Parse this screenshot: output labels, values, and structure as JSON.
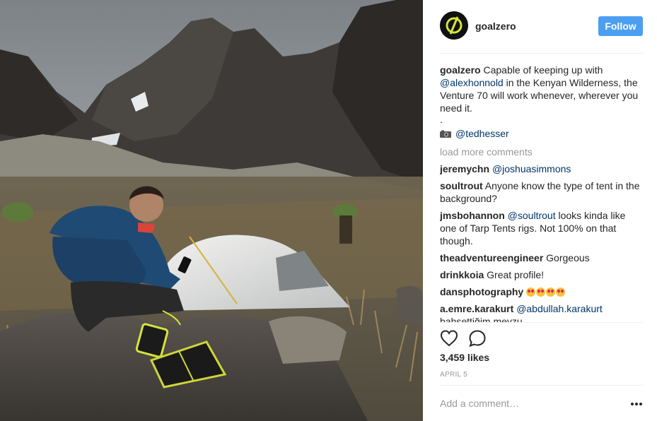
{
  "post": {
    "username": "goalzero",
    "follow_label": "Follow",
    "caption": {
      "username": "goalzero",
      "text_before": "Capable of keeping up with ",
      "mention": "@alexhonnold",
      "text_after": " in the Kenyan Wilderness, the Venture 70 will work whenever, wherever you need it.",
      "dot": ".",
      "credit_icon": "camera-emoji-icon",
      "credit": "@tedhesser"
    },
    "load_more": "load more comments",
    "comments": [
      {
        "user": "jeremychn",
        "mention": "@joshuasimmons",
        "text": ""
      },
      {
        "user": "soultrout",
        "mention": "",
        "text": "Anyone know the type of tent in the background?"
      },
      {
        "user": "jmsbohannon",
        "mention": "@soultrout",
        "text": " looks kinda like one of Tarp Tents rigs. Not 100% on that though."
      },
      {
        "user": "theadventureengineer",
        "mention": "",
        "text": "Gorgeous"
      },
      {
        "user": "drinkkoia",
        "mention": "",
        "text": "Great profile!"
      },
      {
        "user": "dansphotography",
        "mention": "",
        "text": "",
        "emoji": "heart-eyes-emoji x4"
      },
      {
        "user": "a.emre.karakurt",
        "mention": "@abdullah.karakurt",
        "text": ""
      },
      {
        "user": "",
        "mention": "",
        "text": "bahsettiğim meyzu"
      }
    ],
    "likes": "3,459 likes",
    "date": "APRIL 5",
    "add_comment_placeholder": "Add a comment…",
    "colors": {
      "follow": "#4c9ff0",
      "mention": "#003569",
      "muted": "#999999"
    }
  }
}
